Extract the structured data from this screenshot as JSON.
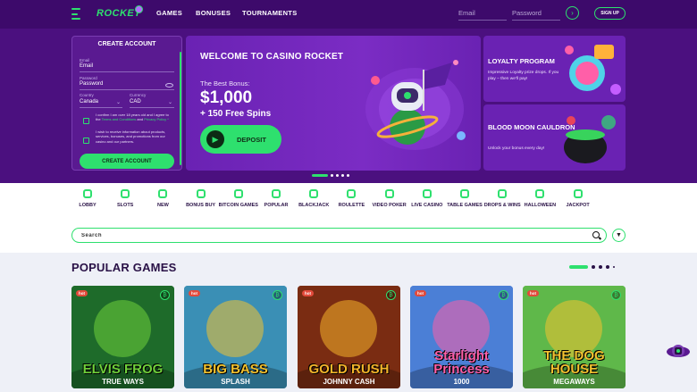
{
  "header": {
    "logo": "ROCKET",
    "nav": [
      "GAMES",
      "BONUSES",
      "TOURNAMENTS"
    ],
    "email_placeholder": "Email",
    "password_placeholder": "Password",
    "signup_label": "SIGN UP",
    "go_symbol": "›"
  },
  "create_account": {
    "title": "CREATE ACCOUNT",
    "email_label": "Email",
    "email_value": "Email",
    "password_label": "Password",
    "password_value": "Password",
    "country_label": "Country",
    "country_value": "Canada",
    "currency_label": "Currency",
    "currency_value": "CAD",
    "terms_text_a": "I confirm I am over 18 years old and I agree to the",
    "terms_link": "Terms and Conditions",
    "terms_text_b": "and",
    "privacy_link": "Privacy Policy",
    "terms_asterisk": "*",
    "promo_text": "I wish to receive information about products, services, bonuses, and promotions from our casino and our partners.",
    "button_label": "CREATE ACCOUNT"
  },
  "welcome": {
    "title": "WELCOME TO CASINO ROCKET",
    "subtitle": "The Best Bonus:",
    "amount": "$1,000",
    "spins": "+ 150 Free Spins",
    "button_label": "DEPOSIT"
  },
  "hero_slider": {
    "count": 5,
    "active_index": 0
  },
  "promos": [
    {
      "title": "LOYALTY PROGRAM",
      "desc": "Impressive Loyalty prize drops. If you play – then we'll pay!"
    },
    {
      "title": "BLOOD MOON CAULDRON",
      "desc": "Unlock your bonus every day!"
    }
  ],
  "categories": [
    {
      "label": "LOBBY",
      "icon": "lobby-icon"
    },
    {
      "label": "SLOTS",
      "icon": "slots-icon"
    },
    {
      "label": "NEW",
      "icon": "new-icon"
    },
    {
      "label": "BONUS BUY",
      "icon": "bonus-buy-icon"
    },
    {
      "label": "BITCOIN GAMES",
      "icon": "bitcoin-icon"
    },
    {
      "label": "POPULAR",
      "icon": "popular-icon"
    },
    {
      "label": "BLACKJACK",
      "icon": "blackjack-icon"
    },
    {
      "label": "ROULETTE",
      "icon": "roulette-icon"
    },
    {
      "label": "VIDEO POKER",
      "icon": "video-poker-icon"
    },
    {
      "label": "LIVE CASINO",
      "icon": "live-casino-icon"
    },
    {
      "label": "TABLE GAMES",
      "icon": "table-games-icon"
    },
    {
      "label": "DROPS & WINS",
      "icon": "drops-wins-icon"
    },
    {
      "label": "HALLOWEEN",
      "icon": "halloween-icon"
    },
    {
      "label": "JACKPOT",
      "icon": "jackpot-icon"
    }
  ],
  "search": {
    "placeholder": "Search"
  },
  "popular": {
    "title": "POPULAR GAMES",
    "slider_count": 5,
    "active_index": 0,
    "badge": "hot",
    "games": [
      {
        "name": "ELVIS FROG",
        "sub": "TRUE WAYS",
        "bg": "#1e6b2a",
        "accent": "#6fd13a"
      },
      {
        "name": "BIG BASS",
        "sub": "SPLASH",
        "bg": "#3a8fb5",
        "accent": "#f2c230"
      },
      {
        "name": "GOLD RUSH",
        "sub": "JOHNNY CASH",
        "bg": "#7a2c12",
        "accent": "#f5b52a"
      },
      {
        "name": "Starlight Princess",
        "sub": "1000",
        "bg": "#4b7fd6",
        "accent": "#ff5fa8"
      },
      {
        "name": "THE DOG HOUSE",
        "sub": "MEGAWAYS",
        "bg": "#5fb84a",
        "accent": "#f2c230"
      }
    ]
  },
  "colors": {
    "brand_green": "#2ee06e",
    "hero_purple": "#4b107f",
    "card_purple": "#6a22b3",
    "text_dark": "#2a1247"
  }
}
